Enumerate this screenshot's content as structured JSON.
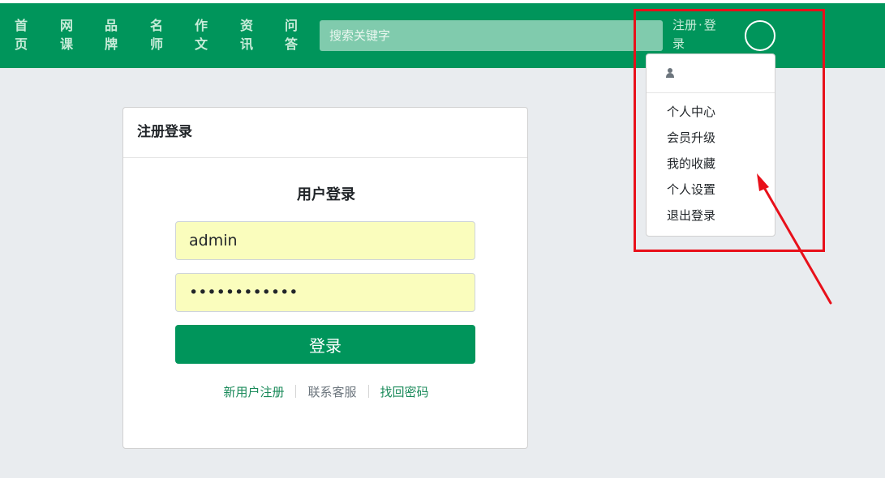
{
  "nav": {
    "items": [
      {
        "chars": [
          "首",
          "页"
        ]
      },
      {
        "chars": [
          "网",
          "课"
        ]
      },
      {
        "chars": [
          "品",
          "牌"
        ]
      },
      {
        "chars": [
          "名",
          "师"
        ]
      },
      {
        "chars": [
          "作",
          "文"
        ]
      },
      {
        "chars": [
          "资",
          "讯"
        ]
      },
      {
        "chars": [
          "问",
          "答"
        ]
      }
    ],
    "search_placeholder": "搜索关键字",
    "auth": {
      "register": "注册",
      "separator": "·",
      "login_1": "登",
      "login_2": "录"
    }
  },
  "dropdown": {
    "user_icon": "user-icon",
    "items": [
      "个人中心",
      "会员升级",
      "我的收藏",
      "个人设置",
      "退出登录"
    ]
  },
  "card": {
    "header": "注册登录",
    "title": "用户登录",
    "username_value": "admin",
    "password_value": "••••••••••••",
    "login_button": "登录",
    "links": {
      "register": "新用户注册",
      "support": "联系客服",
      "recover": "找回密码"
    }
  },
  "colors": {
    "brand": "#00955b",
    "annotation": "#e8101a",
    "background": "#e9ecef"
  }
}
